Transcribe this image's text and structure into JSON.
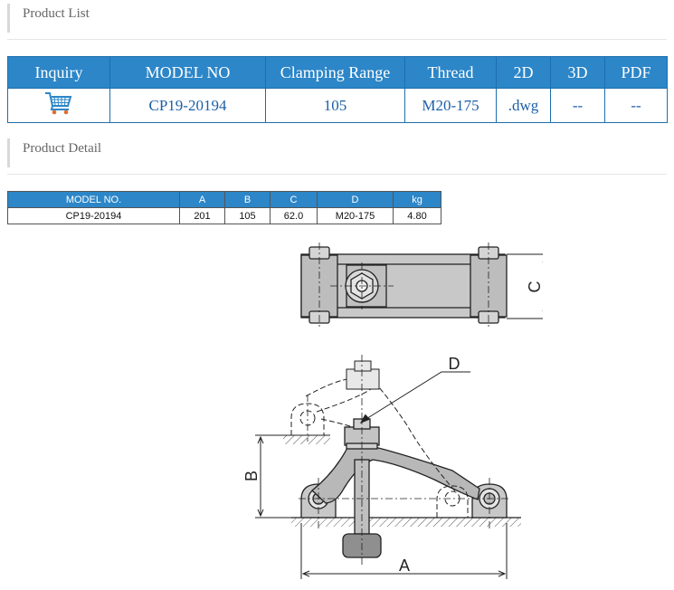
{
  "product_list": {
    "heading": "Product List",
    "columns": [
      "Inquiry",
      "MODEL NO",
      "Clamping Range",
      "Thread",
      "2D",
      "3D",
      "PDF"
    ],
    "row": {
      "inquiry_icon": "shopping-cart-icon",
      "model_no": "CP19-20194",
      "clamping_range": "105",
      "thread": "M20-175",
      "d2": ".dwg",
      "d3": "--",
      "pdf": "--"
    }
  },
  "product_detail": {
    "heading": "Product Detail",
    "columns": [
      "MODEL NO.",
      "A",
      "B",
      "C",
      "D",
      "kg"
    ],
    "row": [
      "CP19-20194",
      "201",
      "105",
      "62.0",
      "M20-175",
      "4.80"
    ]
  },
  "drawing": {
    "label_c": "C",
    "label_d": "D",
    "label_b": "B",
    "label_a": "A"
  },
  "colors": {
    "header_blue": "#2c86c8",
    "link_blue": "#1d5fa8"
  }
}
